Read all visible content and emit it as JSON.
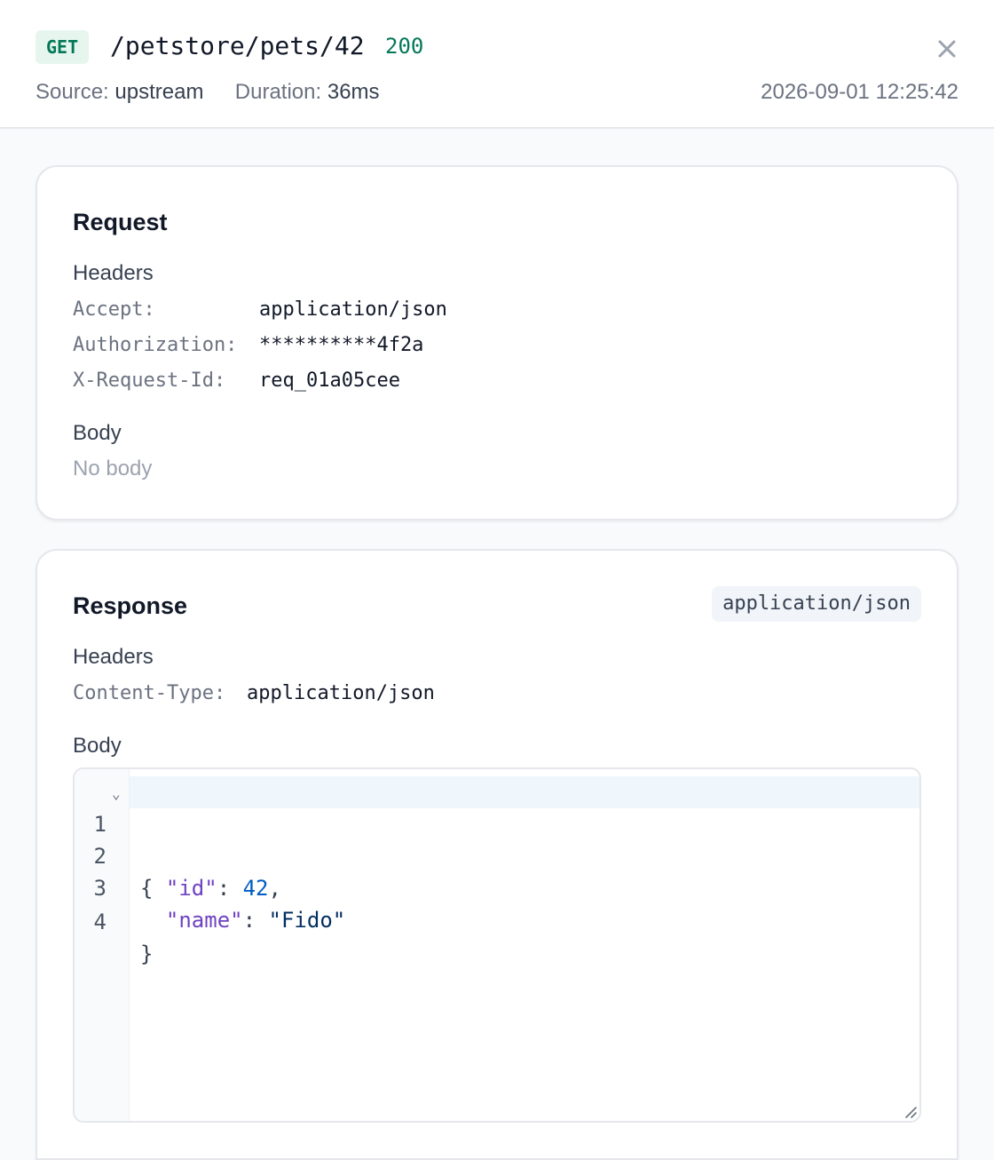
{
  "header": {
    "method": "GET",
    "path": "/petstore/pets/42",
    "status": "200",
    "source_label": "Source:",
    "source_value": "upstream",
    "duration_label": "Duration:",
    "duration_value": "36ms",
    "timestamp": "2026-09-01 12:25:42",
    "close_icon": "close-icon"
  },
  "request": {
    "title": "Request",
    "headers_label": "Headers",
    "headers": [
      {
        "key": "Accept:",
        "value": "application/json"
      },
      {
        "key": "Authorization:",
        "value": "**********4f2a"
      },
      {
        "key": "X-Request-Id:",
        "value": "req_01a05cee"
      }
    ],
    "body_label": "Body",
    "body_empty": "No body"
  },
  "response": {
    "title": "Response",
    "content_type_badge": "application/json",
    "headers_label": "Headers",
    "headers": [
      {
        "key": "Content-Type:",
        "value": "application/json"
      }
    ],
    "body_label": "Body",
    "body_lines": [
      {
        "n": "1",
        "open": "{"
      },
      {
        "n": "2",
        "key": "\"id\"",
        "colon": ": ",
        "num": "42",
        "comma": ","
      },
      {
        "n": "3",
        "key": "\"name\"",
        "colon": ": ",
        "str": "\"Fido\""
      },
      {
        "n": "4",
        "close": "}"
      }
    ]
  },
  "colors": {
    "accent_green": "#047857",
    "method_bg": "#e6f6ee",
    "json_key": "#6f42c1",
    "json_number": "#005cc5",
    "json_string": "#032f62"
  }
}
